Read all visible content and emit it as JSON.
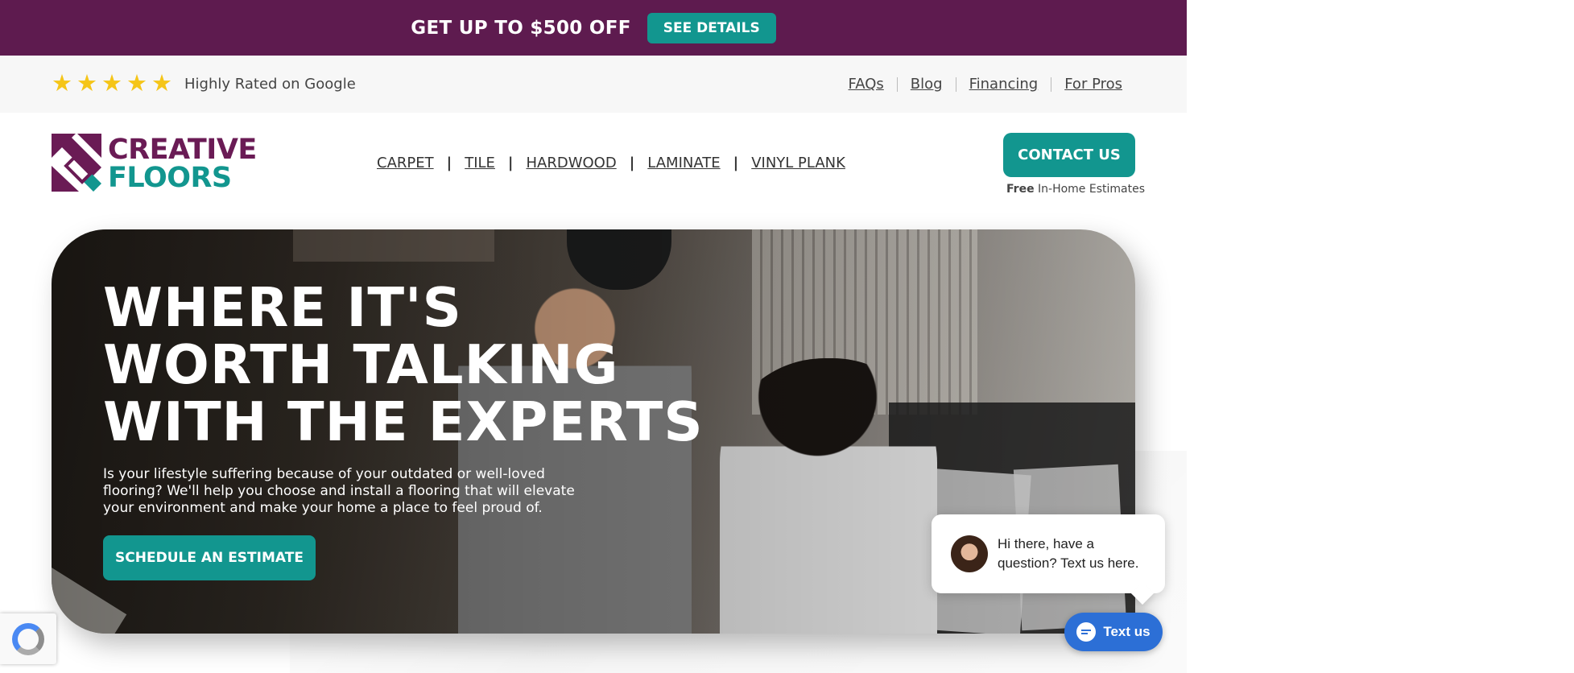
{
  "promo": {
    "text": "GET UP TO $500 OFF",
    "button": "SEE DETAILS"
  },
  "utility": {
    "stars": [
      "★",
      "★",
      "★",
      "★",
      "★"
    ],
    "rating_text": "Highly Rated on Google",
    "links": [
      "FAQs",
      "Blog",
      "Financing",
      "For Pros"
    ]
  },
  "header": {
    "logo_line1": "CREATIVE",
    "logo_line2": "FLOORS",
    "nav": [
      "CARPET",
      "TILE",
      "HARDWOOD",
      "LAMINATE",
      "VINYL PLANK"
    ],
    "nav_separator": "|",
    "contact_button": "CONTACT US",
    "estimate_bold": "Free",
    "estimate_text": "In-Home Estimates"
  },
  "hero": {
    "title_lines": [
      "WHERE IT'S",
      "WORTH TALKING",
      "WITH THE EXPERTS"
    ],
    "body": "Is your lifestyle suffering because of your outdated or well-loved flooring? We'll help you choose and install a flooring that will elevate your environment and make your home a place to feel proud of.",
    "cta": "SCHEDULE AN ESTIMATE"
  },
  "chat": {
    "message": "Hi there, have a question? Text us here.",
    "button": "Text us"
  },
  "colors": {
    "promo_bg": "#5e1b4f",
    "teal": "#12968f",
    "logo_purple": "#6a1b55",
    "chat_blue": "#2c6fd6",
    "star": "#f5c518"
  },
  "icons": {
    "logo": "creative-floors-logo-icon",
    "star": "star-icon",
    "chat": "chat-icon",
    "recaptcha": "recaptcha-icon"
  }
}
